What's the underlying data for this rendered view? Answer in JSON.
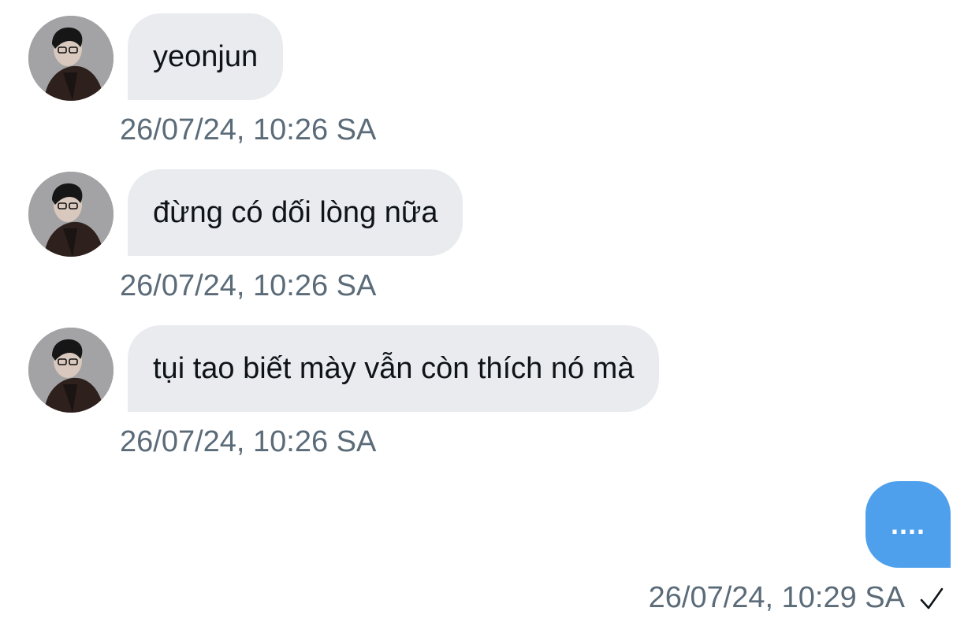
{
  "contact": {
    "avatar_icon": "profile-photo"
  },
  "messages": [
    {
      "sender": "contact",
      "text": "yeonjun",
      "timestamp": "26/07/24, 10:26 SA"
    },
    {
      "sender": "contact",
      "text": "đừng có dối lòng nữa",
      "timestamp": "26/07/24, 10:26 SA"
    },
    {
      "sender": "contact",
      "text": "tụi tao biết mày vẫn còn thích nó mà",
      "timestamp": "26/07/24, 10:26 SA"
    },
    {
      "sender": "me",
      "text": "....",
      "timestamp": "26/07/24, 10:29 SA",
      "status_icon": "checkmark-icon"
    }
  ],
  "colors": {
    "incoming_bubble": "#e9ebef",
    "outgoing_bubble": "#4fa0ec",
    "timestamp_text": "#5b6b78",
    "message_text": "#0f1419"
  }
}
